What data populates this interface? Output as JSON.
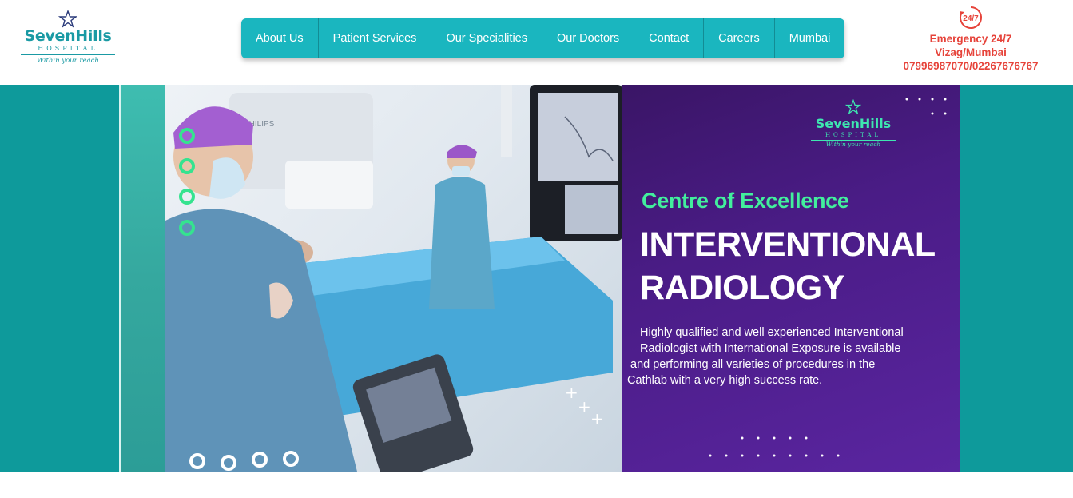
{
  "logo": {
    "brand": "SevenHills",
    "sub": "HOSPITAL",
    "tagline": "Within your reach"
  },
  "nav": {
    "items": [
      {
        "label": "About Us"
      },
      {
        "label": "Patient Services"
      },
      {
        "label": "Our Specialities"
      },
      {
        "label": "Our Doctors"
      },
      {
        "label": "Contact"
      },
      {
        "label": "Careers"
      },
      {
        "label": "Mumbai"
      }
    ]
  },
  "emergency": {
    "badge": "24/7",
    "line1": "Emergency 24/7",
    "line2": "Vizag/Mumbai",
    "phones": "07996987070/02267676767"
  },
  "banner": {
    "monitor_brand": "PHILIPS",
    "logo_brand": "SevenHills",
    "logo_sub": "HOSPITAL",
    "logo_tagline": "Within your reach",
    "kicker": "Centre of Excellence",
    "title_line1": "INTERVENTIONAL",
    "title_line2": "RADIOLOGY",
    "description": [
      "Highly qualified and well experienced Interventional",
      "Radiologist with International Exposure is available",
      "and performing all varieties of  procedures in the",
      "Cathlab with a very high success rate."
    ]
  },
  "colors": {
    "teal": "#1ab6bf",
    "banner_teal": "#0e9a9b",
    "emergency_red": "#e6433a",
    "purple": "#4a1c86",
    "accent_green": "#42ef9d"
  }
}
